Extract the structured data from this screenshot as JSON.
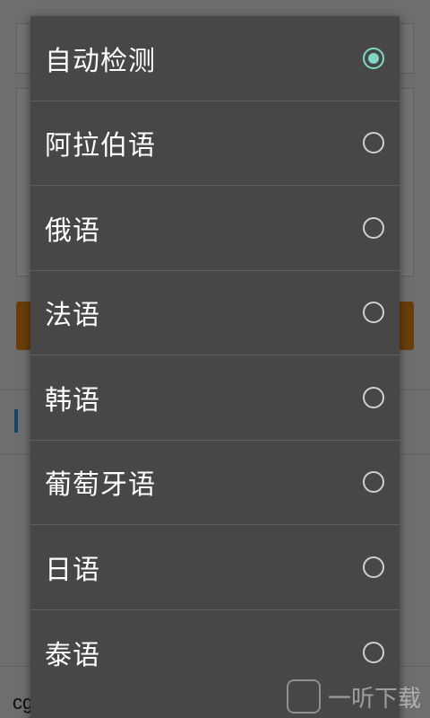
{
  "dialog": {
    "options": [
      {
        "label": "自动检测",
        "selected": true
      },
      {
        "label": "阿拉伯语",
        "selected": false
      },
      {
        "label": "俄语",
        "selected": false
      },
      {
        "label": "法语",
        "selected": false
      },
      {
        "label": "韩语",
        "selected": false
      },
      {
        "label": "葡萄牙语",
        "selected": false
      },
      {
        "label": "日语",
        "selected": false
      },
      {
        "label": "泰语",
        "selected": false
      }
    ]
  },
  "background": {
    "footer_text": "cg"
  },
  "watermark": {
    "text": "一听下载"
  },
  "colors": {
    "radio_selected": "#7ed9c6",
    "dialog_bg": "#474747",
    "bg_button": "#e88a1a",
    "bg_section_marker": "#2b9ddb"
  }
}
